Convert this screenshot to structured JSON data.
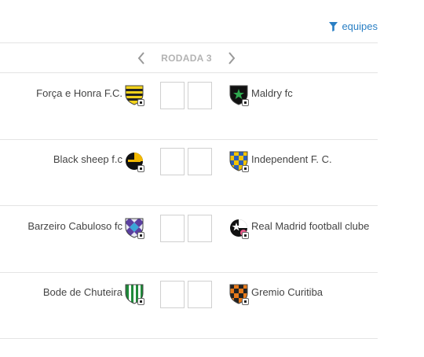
{
  "filter": {
    "label": "equipes",
    "icon": "filter-icon",
    "color": "#2a7fc4"
  },
  "round": {
    "label": "RODADA 3",
    "prev_icon": "chevron-left-icon",
    "next_icon": "chevron-right-icon"
  },
  "matches": [
    {
      "home": {
        "name": "Força e Honra F.C.",
        "crest_icon": "striped-shield-icon"
      },
      "away": {
        "name": "Maldry fc",
        "crest_icon": "green-star-shield-icon"
      },
      "home_score": "",
      "away_score": ""
    },
    {
      "home": {
        "name": "Black sheep f.c",
        "crest_icon": "round-black-yellow-shield-icon"
      },
      "away": {
        "name": "Independent F. C.",
        "crest_icon": "checkered-shield-icon"
      },
      "home_score": "",
      "away_score": ""
    },
    {
      "home": {
        "name": "Barzeiro Cabuloso fc",
        "crest_icon": "diamond-pattern-shield-icon"
      },
      "away": {
        "name": "Real Madrid football clube",
        "crest_icon": "black-star-shield-icon"
      },
      "home_score": "",
      "away_score": ""
    },
    {
      "home": {
        "name": "Bode de Chuteira",
        "crest_icon": "green-stripes-shield-icon"
      },
      "away": {
        "name": "Gremio Curitiba",
        "crest_icon": "orange-checkered-shield-icon"
      },
      "home_score": "",
      "away_score": ""
    }
  ]
}
